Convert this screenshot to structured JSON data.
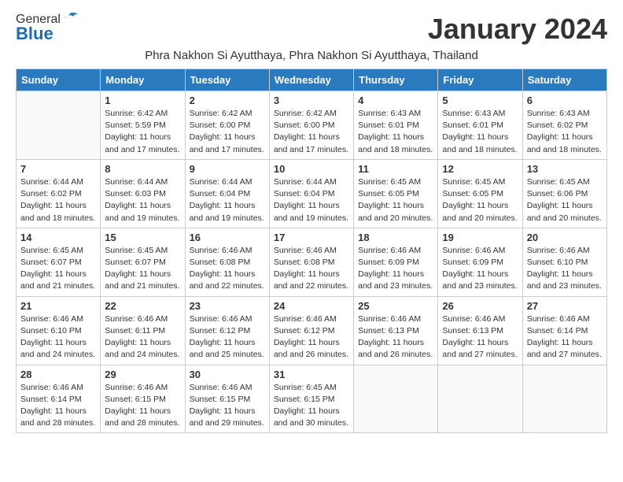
{
  "header": {
    "logo": {
      "line1": "General",
      "line2": "Blue"
    },
    "month_title": "January 2024",
    "subtitle": "Phra Nakhon Si Ayutthaya, Phra Nakhon Si Ayutthaya, Thailand"
  },
  "weekdays": [
    "Sunday",
    "Monday",
    "Tuesday",
    "Wednesday",
    "Thursday",
    "Friday",
    "Saturday"
  ],
  "weeks": [
    [
      {
        "day": "",
        "sunrise": "",
        "sunset": "",
        "daylight": ""
      },
      {
        "day": "1",
        "sunrise": "Sunrise: 6:42 AM",
        "sunset": "Sunset: 5:59 PM",
        "daylight": "Daylight: 11 hours and 17 minutes."
      },
      {
        "day": "2",
        "sunrise": "Sunrise: 6:42 AM",
        "sunset": "Sunset: 6:00 PM",
        "daylight": "Daylight: 11 hours and 17 minutes."
      },
      {
        "day": "3",
        "sunrise": "Sunrise: 6:42 AM",
        "sunset": "Sunset: 6:00 PM",
        "daylight": "Daylight: 11 hours and 17 minutes."
      },
      {
        "day": "4",
        "sunrise": "Sunrise: 6:43 AM",
        "sunset": "Sunset: 6:01 PM",
        "daylight": "Daylight: 11 hours and 18 minutes."
      },
      {
        "day": "5",
        "sunrise": "Sunrise: 6:43 AM",
        "sunset": "Sunset: 6:01 PM",
        "daylight": "Daylight: 11 hours and 18 minutes."
      },
      {
        "day": "6",
        "sunrise": "Sunrise: 6:43 AM",
        "sunset": "Sunset: 6:02 PM",
        "daylight": "Daylight: 11 hours and 18 minutes."
      }
    ],
    [
      {
        "day": "7",
        "sunrise": "Sunrise: 6:44 AM",
        "sunset": "Sunset: 6:02 PM",
        "daylight": "Daylight: 11 hours and 18 minutes."
      },
      {
        "day": "8",
        "sunrise": "Sunrise: 6:44 AM",
        "sunset": "Sunset: 6:03 PM",
        "daylight": "Daylight: 11 hours and 19 minutes."
      },
      {
        "day": "9",
        "sunrise": "Sunrise: 6:44 AM",
        "sunset": "Sunset: 6:04 PM",
        "daylight": "Daylight: 11 hours and 19 minutes."
      },
      {
        "day": "10",
        "sunrise": "Sunrise: 6:44 AM",
        "sunset": "Sunset: 6:04 PM",
        "daylight": "Daylight: 11 hours and 19 minutes."
      },
      {
        "day": "11",
        "sunrise": "Sunrise: 6:45 AM",
        "sunset": "Sunset: 6:05 PM",
        "daylight": "Daylight: 11 hours and 20 minutes."
      },
      {
        "day": "12",
        "sunrise": "Sunrise: 6:45 AM",
        "sunset": "Sunset: 6:05 PM",
        "daylight": "Daylight: 11 hours and 20 minutes."
      },
      {
        "day": "13",
        "sunrise": "Sunrise: 6:45 AM",
        "sunset": "Sunset: 6:06 PM",
        "daylight": "Daylight: 11 hours and 20 minutes."
      }
    ],
    [
      {
        "day": "14",
        "sunrise": "Sunrise: 6:45 AM",
        "sunset": "Sunset: 6:07 PM",
        "daylight": "Daylight: 11 hours and 21 minutes."
      },
      {
        "day": "15",
        "sunrise": "Sunrise: 6:45 AM",
        "sunset": "Sunset: 6:07 PM",
        "daylight": "Daylight: 11 hours and 21 minutes."
      },
      {
        "day": "16",
        "sunrise": "Sunrise: 6:46 AM",
        "sunset": "Sunset: 6:08 PM",
        "daylight": "Daylight: 11 hours and 22 minutes."
      },
      {
        "day": "17",
        "sunrise": "Sunrise: 6:46 AM",
        "sunset": "Sunset: 6:08 PM",
        "daylight": "Daylight: 11 hours and 22 minutes."
      },
      {
        "day": "18",
        "sunrise": "Sunrise: 6:46 AM",
        "sunset": "Sunset: 6:09 PM",
        "daylight": "Daylight: 11 hours and 23 minutes."
      },
      {
        "day": "19",
        "sunrise": "Sunrise: 6:46 AM",
        "sunset": "Sunset: 6:09 PM",
        "daylight": "Daylight: 11 hours and 23 minutes."
      },
      {
        "day": "20",
        "sunrise": "Sunrise: 6:46 AM",
        "sunset": "Sunset: 6:10 PM",
        "daylight": "Daylight: 11 hours and 23 minutes."
      }
    ],
    [
      {
        "day": "21",
        "sunrise": "Sunrise: 6:46 AM",
        "sunset": "Sunset: 6:10 PM",
        "daylight": "Daylight: 11 hours and 24 minutes."
      },
      {
        "day": "22",
        "sunrise": "Sunrise: 6:46 AM",
        "sunset": "Sunset: 6:11 PM",
        "daylight": "Daylight: 11 hours and 24 minutes."
      },
      {
        "day": "23",
        "sunrise": "Sunrise: 6:46 AM",
        "sunset": "Sunset: 6:12 PM",
        "daylight": "Daylight: 11 hours and 25 minutes."
      },
      {
        "day": "24",
        "sunrise": "Sunrise: 6:46 AM",
        "sunset": "Sunset: 6:12 PM",
        "daylight": "Daylight: 11 hours and 26 minutes."
      },
      {
        "day": "25",
        "sunrise": "Sunrise: 6:46 AM",
        "sunset": "Sunset: 6:13 PM",
        "daylight": "Daylight: 11 hours and 26 minutes."
      },
      {
        "day": "26",
        "sunrise": "Sunrise: 6:46 AM",
        "sunset": "Sunset: 6:13 PM",
        "daylight": "Daylight: 11 hours and 27 minutes."
      },
      {
        "day": "27",
        "sunrise": "Sunrise: 6:46 AM",
        "sunset": "Sunset: 6:14 PM",
        "daylight": "Daylight: 11 hours and 27 minutes."
      }
    ],
    [
      {
        "day": "28",
        "sunrise": "Sunrise: 6:46 AM",
        "sunset": "Sunset: 6:14 PM",
        "daylight": "Daylight: 11 hours and 28 minutes."
      },
      {
        "day": "29",
        "sunrise": "Sunrise: 6:46 AM",
        "sunset": "Sunset: 6:15 PM",
        "daylight": "Daylight: 11 hours and 28 minutes."
      },
      {
        "day": "30",
        "sunrise": "Sunrise: 6:46 AM",
        "sunset": "Sunset: 6:15 PM",
        "daylight": "Daylight: 11 hours and 29 minutes."
      },
      {
        "day": "31",
        "sunrise": "Sunrise: 6:45 AM",
        "sunset": "Sunset: 6:15 PM",
        "daylight": "Daylight: 11 hours and 30 minutes."
      },
      {
        "day": "",
        "sunrise": "",
        "sunset": "",
        "daylight": ""
      },
      {
        "day": "",
        "sunrise": "",
        "sunset": "",
        "daylight": ""
      },
      {
        "day": "",
        "sunrise": "",
        "sunset": "",
        "daylight": ""
      }
    ]
  ]
}
